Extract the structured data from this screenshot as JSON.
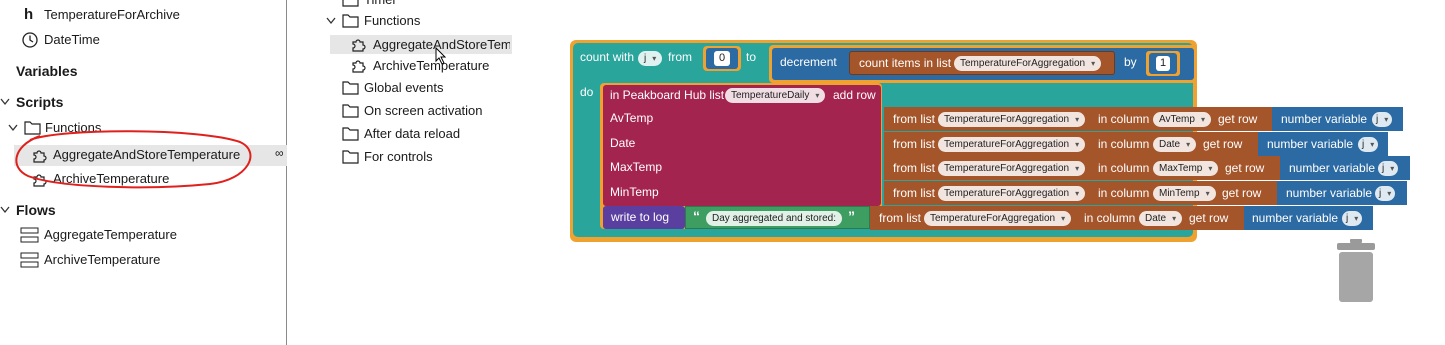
{
  "left_tree": {
    "item_top": "TemperatureForArchive",
    "item_datetime": "DateTime",
    "section_variables": "Variables",
    "section_scripts": "Scripts",
    "folder_functions": "Functions",
    "func_aggregate": "AggregateAndStoreTemperature",
    "func_archive": "ArchiveTemperature",
    "section_flows": "Flows",
    "flow_aggregate": "AggregateTemperature",
    "flow_archive": "ArchiveTemperature",
    "more_glyph": "∞"
  },
  "mid_tree": {
    "timer": "Timer",
    "functions": "Functions",
    "func_aggregate": "AggregateAndStoreTem",
    "func_archive": "ArchiveTemperature",
    "global_events": "Global events",
    "on_screen_activation": "On screen activation",
    "after_data_reload": "After data reload",
    "for_controls": "For controls"
  },
  "blocks": {
    "count_with": "count with",
    "var_j": "j",
    "from": "from",
    "from_value": "0",
    "to": "to",
    "decrement": "decrement",
    "count_items_in_list": "count items in list",
    "list_name": "TemperatureForAggregation",
    "by": "by",
    "by_value": "1",
    "do": "do",
    "hub_prefix": "in Peakboard Hub list",
    "hub_list": "TemperatureDaily",
    "add_row": "add row",
    "field_avtemp": "AvTemp",
    "field_date": "Date",
    "field_maxtemp": "MaxTemp",
    "field_mintemp": "MinTemp",
    "from_list": "from list",
    "in_column": "in column",
    "get_row": "get row",
    "number_variable": "number variable",
    "col_avtemp": "AvTemp",
    "col_date": "Date",
    "col_maxtemp": "MaxTemp",
    "col_mintemp": "MinTemp",
    "write_to_log": "write to log",
    "log_text": "Day aggregated and stored:",
    "open_quote": "“",
    "close_quote": "”",
    "dropdown_arrow": "▾"
  },
  "colors": {
    "loop": "#f0a230",
    "teal": "#2aa59b",
    "hub": "#a42450",
    "list": "#a5552a",
    "variable": "#2b6aa3",
    "text": "#3e9e62",
    "log": "#5b3fa0",
    "annotation": "#e0201c"
  }
}
